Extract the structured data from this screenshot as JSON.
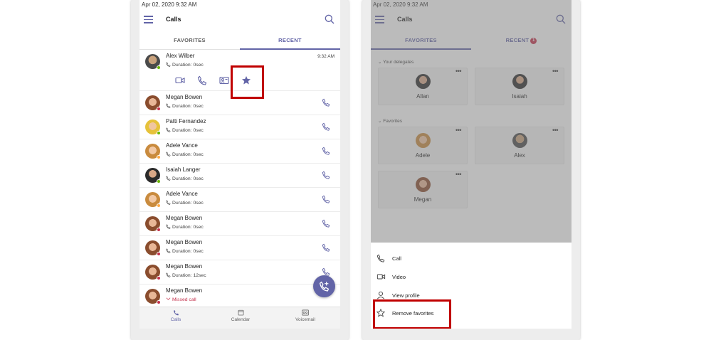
{
  "left": {
    "status_time": "Apr 02, 2020  9:32 AM",
    "title": "Calls",
    "tabs": [
      {
        "label": "FAVORITES"
      },
      {
        "label": "RECENT"
      }
    ],
    "expanded_call": {
      "name": "Alex Wilber",
      "duration": "Duration: 0sec",
      "time": "9:32 AM"
    },
    "calls": [
      {
        "name": "Megan Bowen",
        "duration": "Duration: 0sec"
      },
      {
        "name": "Patti Fernandez",
        "duration": "Duration: 0sec"
      },
      {
        "name": "Adele Vance",
        "duration": "Duration: 0sec"
      },
      {
        "name": "Isaiah Langer",
        "duration": "Duration: 0sec"
      },
      {
        "name": "Adele Vance",
        "duration": "Duration: 0sec"
      },
      {
        "name": "Megan Bowen",
        "duration": "Duration: 0sec"
      },
      {
        "name": "Megan Bowen",
        "duration": "Duration: 0sec"
      },
      {
        "name": "Megan Bowen",
        "duration": "Duration: 12sec"
      },
      {
        "name": "Megan Bowen",
        "duration": "Missed call"
      }
    ],
    "bottom_nav": [
      {
        "label": "Calls"
      },
      {
        "label": "Calendar"
      },
      {
        "label": "Voicemail"
      }
    ]
  },
  "right": {
    "status_time": "Apr 02, 2020  9:32 AM",
    "title": "Calls",
    "tabs": [
      {
        "label": "FAVORITES"
      },
      {
        "label": "RECENT"
      }
    ],
    "recent_badge": "1",
    "delegates_header": "Your delegates",
    "favorites_header": "Favorites",
    "delegates": [
      {
        "name": "Allan"
      },
      {
        "name": "Isaiah"
      }
    ],
    "favorites": [
      {
        "name": "Adele"
      },
      {
        "name": "Alex"
      },
      {
        "name": "Megan"
      }
    ],
    "more_label": "•••",
    "menu": [
      {
        "label": "Call"
      },
      {
        "label": "Video"
      },
      {
        "label": "View profile"
      },
      {
        "label": "Remove favorites"
      }
    ]
  },
  "colors": {
    "accent": "#6264a7",
    "highlight": "#c00000",
    "missed": "#c4314b",
    "presence_busy": "#c4314b",
    "presence_available": "#6bb700"
  }
}
